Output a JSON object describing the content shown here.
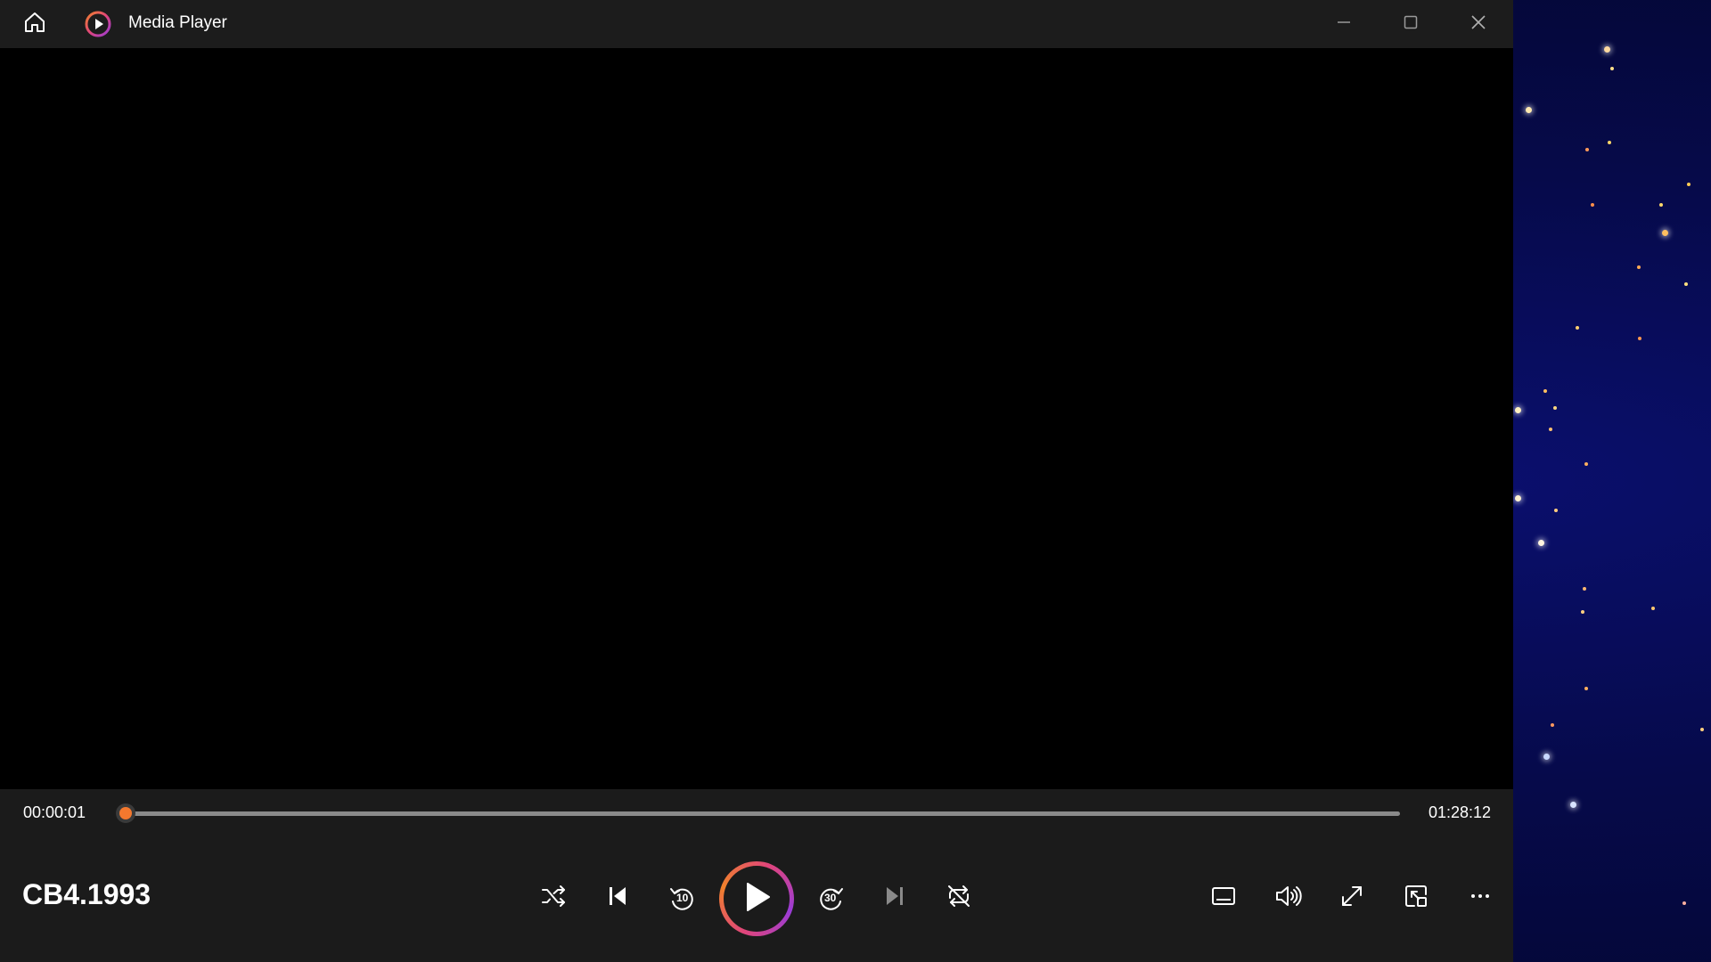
{
  "window": {
    "title": "Media Player",
    "accent_color": "#f4782e",
    "minimize_icon": "minimize-icon",
    "maximize_icon": "maximize-icon",
    "close_icon": "close-icon"
  },
  "playback": {
    "current_time": "00:00:01",
    "total_time": "01:28:12",
    "progress_fraction": 0.0002
  },
  "media": {
    "title": "CB4.1993"
  },
  "controls": {
    "shuffle_icon": "shuffle-icon",
    "previous_icon": "previous-icon",
    "skip_back_label": "10",
    "play_icon": "play-icon",
    "skip_forward_label": "30",
    "next_icon": "next-icon",
    "repeat_icon": "repeat-off-icon",
    "captions_icon": "captions-icon",
    "volume_icon": "volume-icon",
    "fullscreen_icon": "fullscreen-icon",
    "miniplayer_icon": "miniplayer-icon",
    "more_icon": "more-icon"
  }
}
